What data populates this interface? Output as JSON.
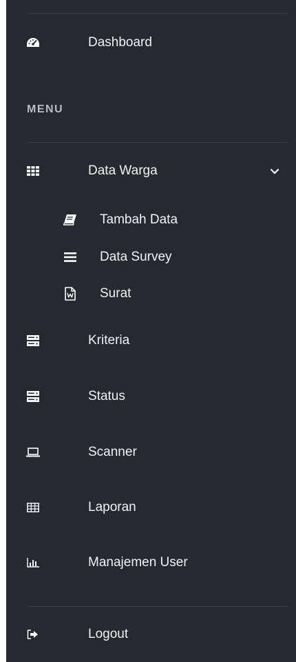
{
  "sidebar": {
    "dashboard": {
      "label": "Dashboard",
      "icon": "dashboard-icon"
    },
    "menu_heading": "MENU",
    "data_warga": {
      "label": "Data Warga",
      "icon": "grid-icon",
      "expanded": true,
      "children": [
        {
          "label": "Tambah Data",
          "icon": "book-icon"
        },
        {
          "label": "Data Survey",
          "icon": "list-icon"
        },
        {
          "label": "Surat",
          "icon": "word-document-icon"
        }
      ]
    },
    "items": [
      {
        "label": "Kriteria",
        "icon": "server-icon"
      },
      {
        "label": "Status",
        "icon": "server-icon"
      },
      {
        "label": "Scanner",
        "icon": "laptop-icon"
      },
      {
        "label": "Laporan",
        "icon": "table-icon"
      },
      {
        "label": "Manajemen User",
        "icon": "bar-chart-icon"
      }
    ],
    "logout": {
      "label": "Logout",
      "icon": "sign-out-icon"
    }
  },
  "colors": {
    "sidebar_bg": "#262930",
    "text": "#f2f2f2",
    "divider": "#3c4048",
    "heading": "#b8bcc4"
  }
}
